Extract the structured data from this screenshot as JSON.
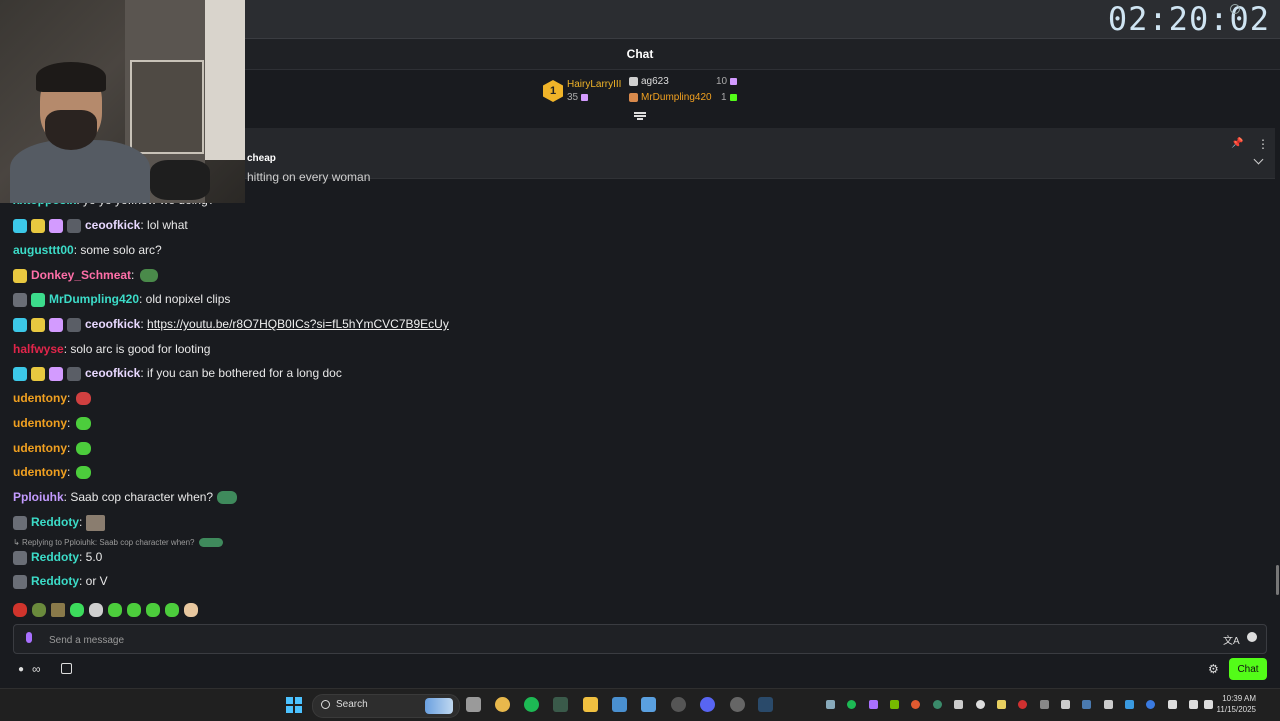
{
  "stream": {
    "timer": "02:20:02"
  },
  "chat": {
    "title": "Chat"
  },
  "leaderboard": {
    "first": {
      "rank": "1",
      "name": "HairyLarryIII",
      "score": "35"
    },
    "second": {
      "name": "ag623",
      "score": "10"
    },
    "third": {
      "name": "MrDumpling420",
      "score": "1"
    }
  },
  "pinned": {
    "text": "cheap",
    "underlying_text": "hitting on every woman"
  },
  "messages": [
    {
      "user": "xxtopposix",
      "text": ": yo yo yo..how we doing?",
      "color": "#3cdcc8"
    },
    {
      "user": "ceoofkick",
      "text": ": lol what",
      "color": "#e8d8ff"
    },
    {
      "user": "augusttt00",
      "text": ": some solo arc?",
      "color": "#3cdcc8"
    },
    {
      "user": "Donkey_Schmeat",
      "text": ":",
      "color": "#ff6fa8"
    },
    {
      "user": "MrDumpling420",
      "text": ": old nopixel clips",
      "color": "#3cdcc8"
    },
    {
      "user": "ceoofkick",
      "text": ": ",
      "link": "https://youtu.be/r8O7HQB0ICs?si=fL5hYmCVC7B9EcUy",
      "color": "#e8d8ff"
    },
    {
      "user": "halfwyse",
      "text": ": solo arc is good for looting",
      "color": "#e0254a"
    },
    {
      "user": "ceoofkick",
      "text": ": if you can be bothered for a long doc",
      "color": "#e8d8ff"
    },
    {
      "user": "udentony",
      "text": ":",
      "color": "#f0a020"
    },
    {
      "user": "udentony",
      "text": ":",
      "color": "#f0a020"
    },
    {
      "user": "udentony",
      "text": ":",
      "color": "#f0a020"
    },
    {
      "user": "udentony",
      "text": ":",
      "color": "#f0a020"
    },
    {
      "user": "Pploiuhk",
      "text": ": Saab cop character when?",
      "color": "#c39bff"
    },
    {
      "user": "Reddoty",
      "text": ":",
      "color": "#3cdcc8"
    },
    {
      "user": "Reddoty",
      "text": ": 5.0",
      "color": "#3cdcc8"
    },
    {
      "user": "Reddoty",
      "text": ": or V",
      "color": "#3cdcc8"
    }
  ],
  "reply": {
    "text": "Replying to Pploiuhk: Saab cop character when?"
  },
  "input": {
    "placeholder": "Send a message"
  },
  "actions": {
    "chat_button": "Chat"
  },
  "taskbar": {
    "search_label": "Search",
    "time": "10:39 AM",
    "date": "11/15/2025"
  },
  "icons": {
    "mic": "microphone-icon",
    "translate": "translate-icon",
    "emoji": "emoji-icon",
    "pin": "pin-icon",
    "more": "more-icon",
    "gear": "gear-icon",
    "store": "store-icon",
    "infinity": "infinity-icon",
    "windows": "windows-icon",
    "search": "search-icon"
  },
  "colors": {
    "accent": "#53fc18",
    "gold": "#f0b429",
    "background": "#191b1f"
  }
}
